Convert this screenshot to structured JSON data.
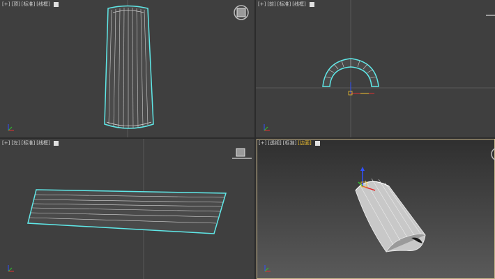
{
  "viewports": {
    "top": {
      "plus": "[+]",
      "view": "[顶]",
      "shading": "[标准]",
      "mode": "[线框]"
    },
    "front": {
      "plus": "[+]",
      "view": "[前]",
      "shading": "[标准]",
      "mode": "[线框]"
    },
    "left": {
      "plus": "[+]",
      "view": "[左]",
      "shading": "[标准]",
      "mode": "[线框]"
    },
    "perspective": {
      "plus": "[+]",
      "view": "[透视]",
      "shading": "[标准]",
      "mode": "[边面]"
    }
  },
  "colors": {
    "selection_outline": "#5fe8e8",
    "active_viewport_border": "#c8b58a",
    "wire": "#e8e8e8",
    "axis_x": "#e03030",
    "axis_y": "#30c030",
    "axis_z": "#3050ff",
    "active_label": "#f0c030"
  },
  "icons": [
    "viewcube-icon",
    "gizmo-icon",
    "axis-tripod-icon"
  ]
}
